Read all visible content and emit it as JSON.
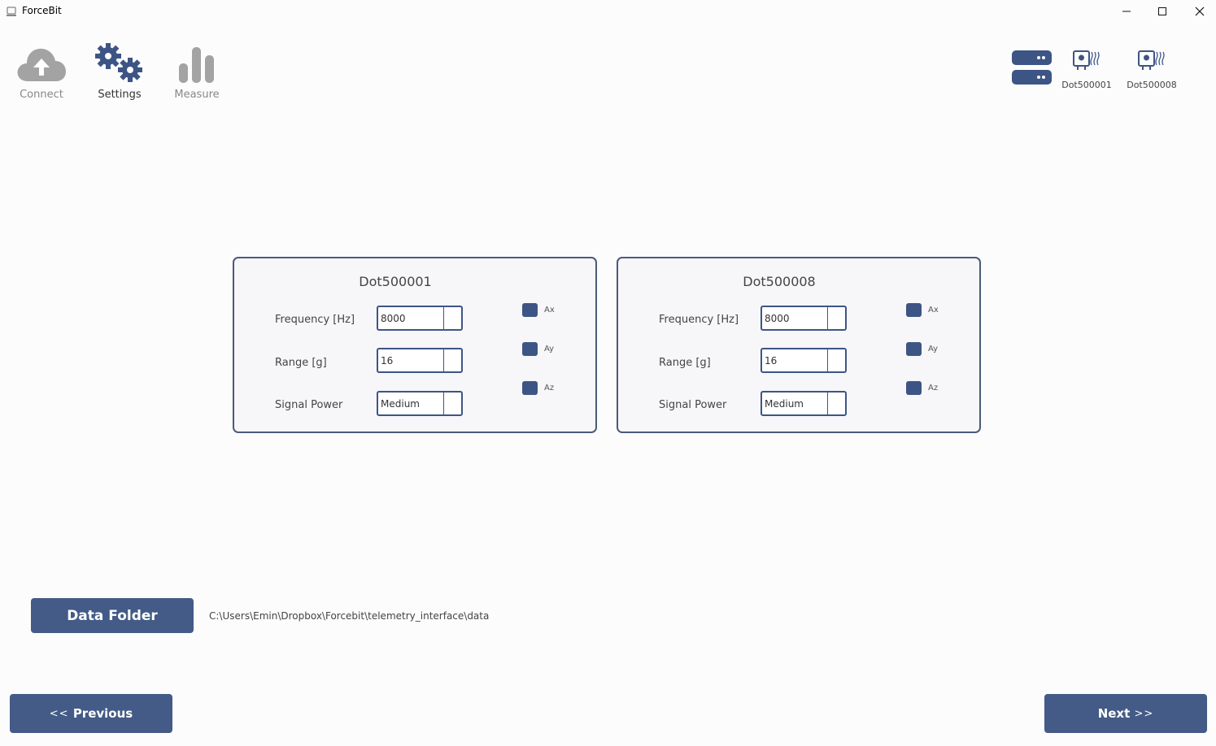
{
  "window": {
    "title": "ForceBit"
  },
  "toolbar": {
    "connect_label": "Connect",
    "settings_label": "Settings",
    "measure_label": "Measure"
  },
  "devices": [
    {
      "name": "Dot500001"
    },
    {
      "name": "Dot500008"
    }
  ],
  "panels": [
    {
      "title": "Dot500001",
      "frequency_label": "Frequency [Hz]",
      "frequency_value": "8000",
      "range_label": "Range [g]",
      "range_value": "16",
      "signal_label": "Signal Power",
      "signal_value": "Medium",
      "axes": [
        "Ax",
        "Ay",
        "Az"
      ]
    },
    {
      "title": "Dot500008",
      "frequency_label": "Frequency [Hz]",
      "frequency_value": "8000",
      "range_label": "Range [g]",
      "range_value": "16",
      "signal_label": "Signal Power",
      "signal_value": "Medium",
      "axes": [
        "Ax",
        "Ay",
        "Az"
      ]
    }
  ],
  "data_folder": {
    "button_label": "Data Folder",
    "path": "C:\\Users\\Emin\\Dropbox\\Forcebit\\telemetry_interface\\data"
  },
  "nav": {
    "previous_arrows": "<<",
    "previous_label": "Previous",
    "next_label": "Next",
    "next_arrows": ">>"
  },
  "colors": {
    "accent": "#435b86",
    "disabled_icon": "#a3a3a3",
    "settings_icon": "#3d5585"
  },
  "icons": {
    "connect": "cloud-upload-icon",
    "settings": "gears-icon",
    "measure": "bar-chart-icon",
    "server": "server-icon",
    "device": "sensor-device-icon"
  }
}
